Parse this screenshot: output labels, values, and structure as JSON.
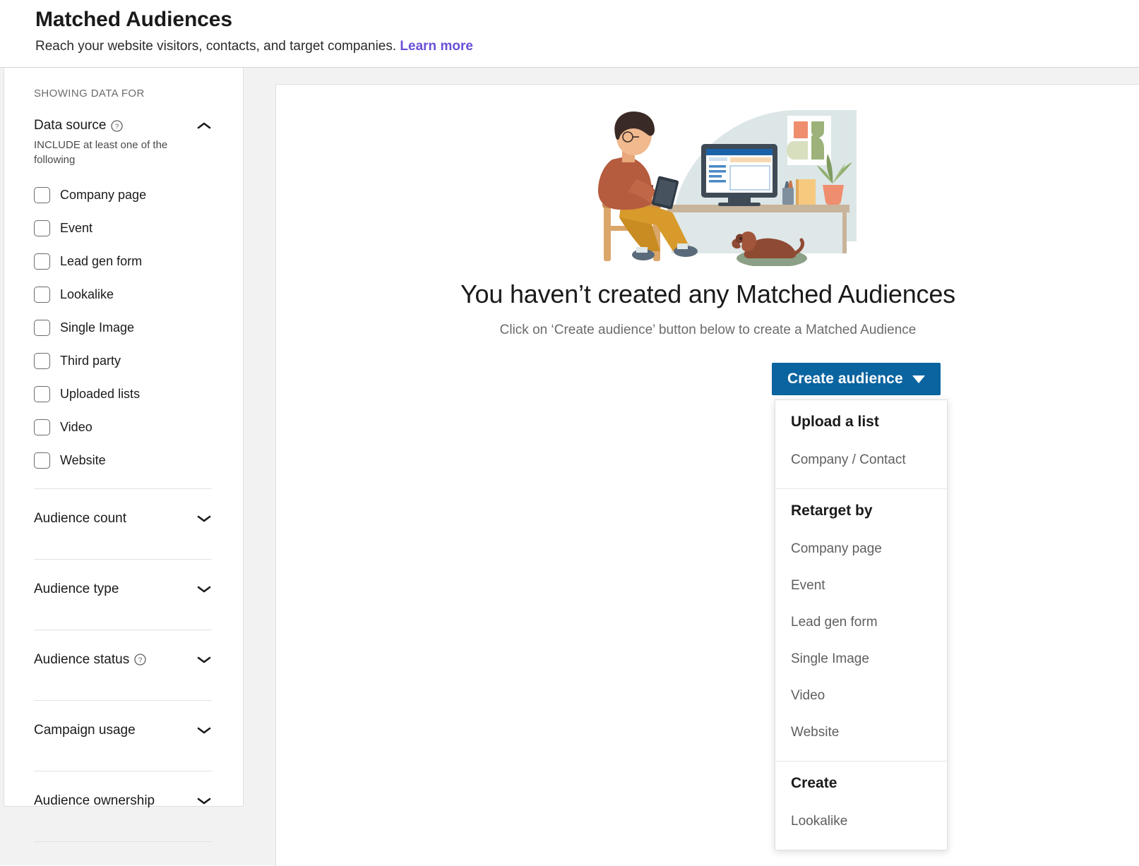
{
  "header": {
    "title": "Matched Audiences",
    "subtitle": "Reach your website visitors, contacts, and target companies.",
    "learn_more": "Learn more"
  },
  "sidebar": {
    "showing_data_for": "SHOWING DATA FOR",
    "data_source": {
      "title": "Data source",
      "help_icon": "help-circle-icon",
      "chevron": "chevron-up-icon",
      "expanded": true,
      "include_note": "INCLUDE at least one of the following",
      "options": [
        {
          "label": "Company page",
          "checked": false
        },
        {
          "label": "Event",
          "checked": false
        },
        {
          "label": "Lead gen form",
          "checked": false
        },
        {
          "label": "Lookalike",
          "checked": false
        },
        {
          "label": "Single Image",
          "checked": false
        },
        {
          "label": "Third party",
          "checked": false
        },
        {
          "label": "Uploaded lists",
          "checked": false
        },
        {
          "label": "Video",
          "checked": false
        },
        {
          "label": "Website",
          "checked": false
        }
      ]
    },
    "collapsed_sections": [
      {
        "label": "Audience count",
        "has_help": false,
        "chevron": "chevron-down-icon"
      },
      {
        "label": "Audience type",
        "has_help": false,
        "chevron": "chevron-down-icon"
      },
      {
        "label": "Audience status",
        "has_help": true,
        "chevron": "chevron-down-icon"
      },
      {
        "label": "Campaign usage",
        "has_help": false,
        "chevron": "chevron-down-icon"
      },
      {
        "label": "Audience ownership",
        "has_help": false,
        "chevron": "chevron-down-icon"
      }
    ]
  },
  "main": {
    "illustration": "person-at-desk-with-tablet-and-dog-illustration",
    "empty_title": "You haven’t created any Matched Audiences",
    "empty_subtitle": "Click on ‘Create audience’ button below to create a Matched Audience",
    "create_button": {
      "label": "Create audience",
      "caret": "caret-down-icon"
    }
  },
  "dropdown": {
    "open": true,
    "groups": [
      {
        "heading": "Upload a list",
        "items": [
          "Company / Contact"
        ]
      },
      {
        "heading": "Retarget by",
        "items": [
          "Company page",
          "Event",
          "Lead gen form",
          "Single Image",
          "Video",
          "Website"
        ]
      },
      {
        "heading": "Create",
        "items": [
          "Lookalike"
        ]
      }
    ]
  },
  "colors": {
    "brand_blue": "#0a64a0",
    "link_purple": "#6b4fd8",
    "page_bg": "#f3f2f2",
    "card_bg": "#ffffff",
    "border": "#e0e0e0",
    "muted_text": "#6b6b6b"
  }
}
